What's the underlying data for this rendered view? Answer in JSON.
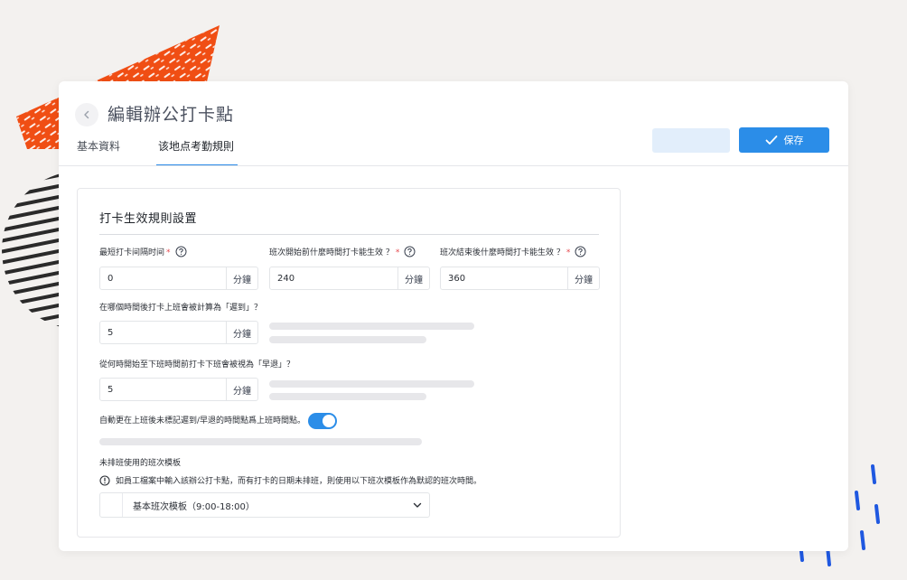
{
  "header": {
    "title": "編輯辦公打卡點",
    "save_label": "保存"
  },
  "tabs": [
    {
      "label": "基本資料"
    },
    {
      "label": "该地点考勤規則"
    }
  ],
  "section": {
    "title": "打卡生效規則設置"
  },
  "fields": {
    "min_interval": {
      "label": "最短打卡间隔时间",
      "value": "0",
      "unit": "分鐘"
    },
    "before_shift": {
      "label": "班次開始前什麼時間打卡能生效 ？",
      "value": "240",
      "unit": "分鐘"
    },
    "after_shift": {
      "label": "班次結束後什麼時間打卡能生效 ？",
      "value": "360",
      "unit": "分鐘"
    },
    "late_after": {
      "label": "在哪個時間後打卡上班會被計算為「遲到」？",
      "value": "5",
      "unit": "分鐘"
    },
    "early_leave": {
      "label": "從何時開始至下班時間前打卡下班會被視為「早退」？",
      "value": "5",
      "unit": "分鐘"
    }
  },
  "required_mark": "*",
  "auto_update": {
    "label": "自動更在上班後未標記遲到/早退的時間點爲上班時間點。",
    "enabled": true
  },
  "template": {
    "heading": "未排班使用的班次模板",
    "info": "如員工檔案中輸入該辦公打卡點，而有打卡的日期未排班，則使用以下班次模板作為默認的班次時間。",
    "selected": "基本班次模板（9:00-18:00）"
  },
  "colors": {
    "accent": "#2b8de8",
    "decor_orange": "#f04e14",
    "decor_blue": "#1f58e0",
    "decor_stripes": "#2a2a2a"
  }
}
